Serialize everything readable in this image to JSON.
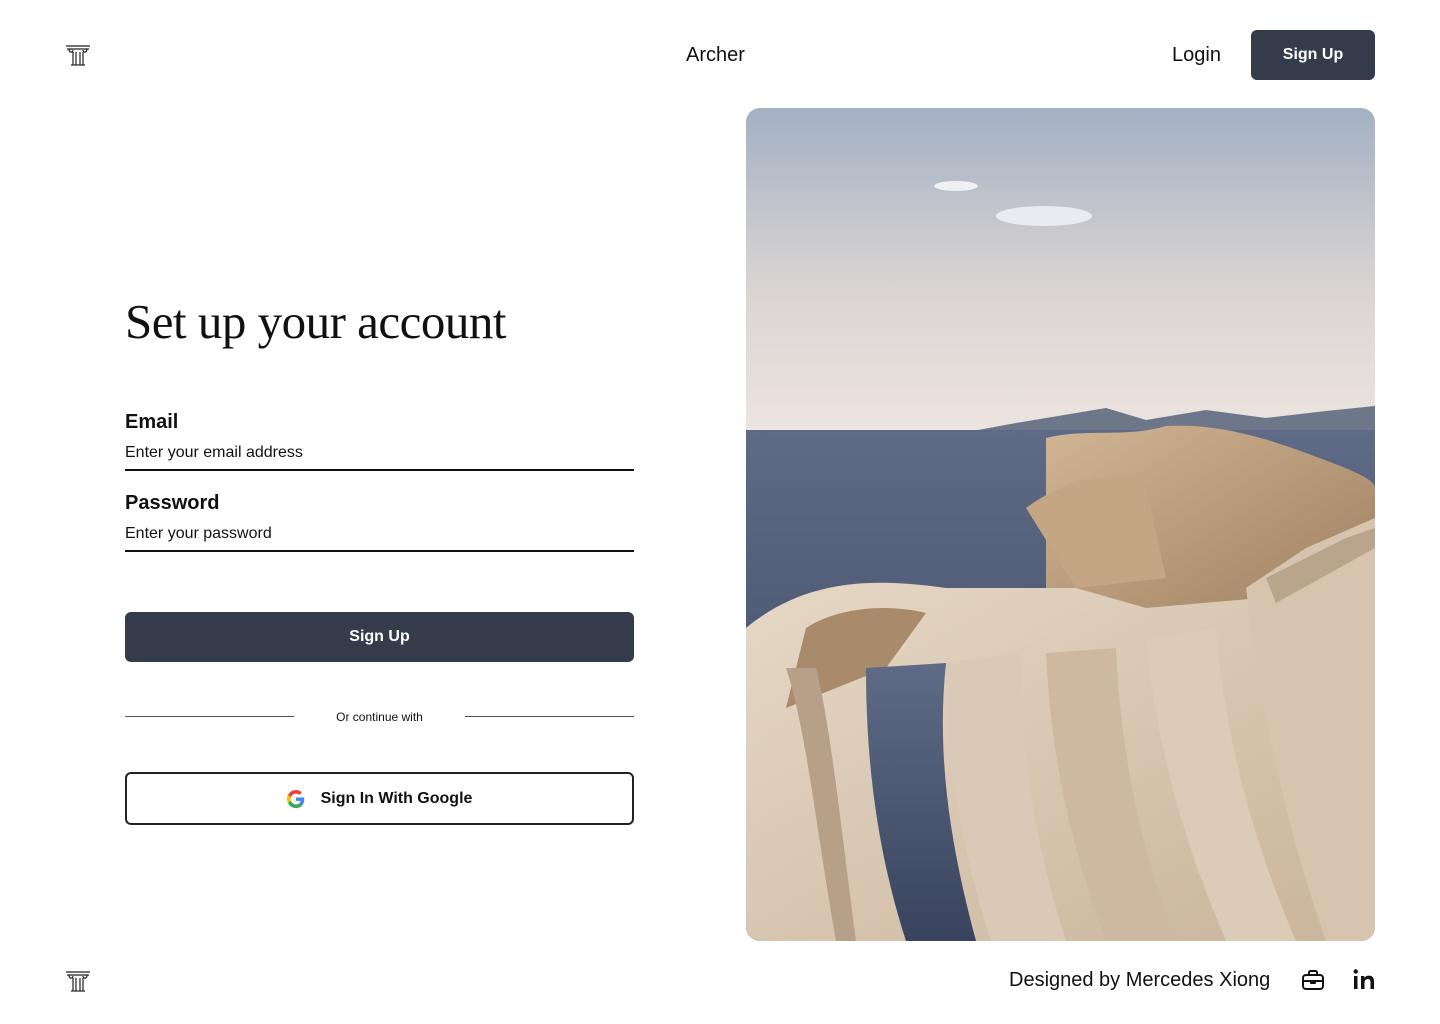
{
  "header": {
    "logo_icon": "column-capital-logo-icon",
    "brand": "Archer",
    "login_label": "Login",
    "signup_label": "Sign Up"
  },
  "form": {
    "title": "Set up your account",
    "email_label": "Email",
    "email_placeholder": "Enter your email address",
    "password_label": "Password",
    "password_placeholder": "Enter your password",
    "submit_label": "Sign Up",
    "divider_text": "Or continue with",
    "google_label": "Sign In With Google",
    "google_icon": "google-g-icon"
  },
  "hero": {
    "image": "coastal-amphitheater-stairs-photo"
  },
  "footer": {
    "logo_icon": "column-capital-logo-icon",
    "credit": "Designed by Mercedes Xiong",
    "icons": [
      "briefcase-icon",
      "linkedin-icon"
    ]
  },
  "colors": {
    "primary_button": "#343c4b",
    "text": "#111111",
    "background": "#ffffff"
  }
}
